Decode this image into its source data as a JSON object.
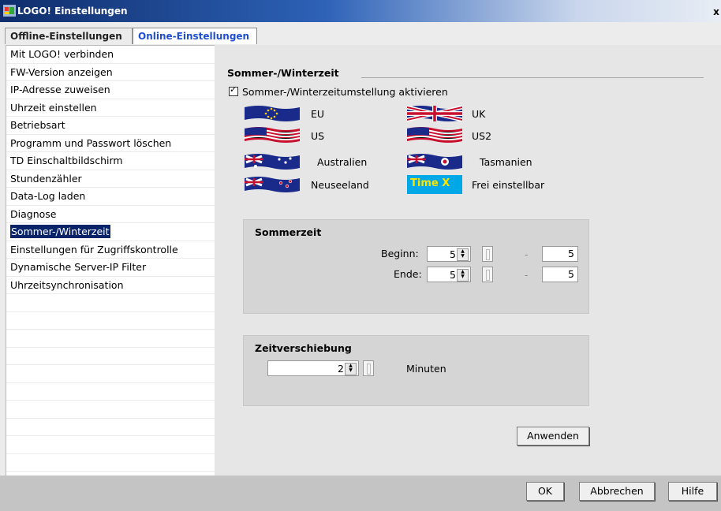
{
  "window": {
    "title": "LOGO! Einstellungen",
    "close_symbol": "x"
  },
  "tabs": [
    {
      "label": "Offline-Einstellungen",
      "active": false
    },
    {
      "label": "Online-Einstellungen",
      "active": true
    }
  ],
  "nav": {
    "items": [
      "Mit LOGO! verbinden",
      "FW-Version anzeigen",
      "IP-Adresse zuweisen",
      "Uhrzeit einstellen",
      "Betriebsart",
      "Programm und Passwort löschen",
      "TD Einschaltbildschirm",
      "Stundenzähler",
      "Data-Log laden",
      "Diagnose",
      "Sommer-/Winterzeit",
      "Einstellungen für Zugriffskontrolle",
      "Dynamische Server-IP Filter",
      "Uhrzeitsynchronisation"
    ],
    "selected_index": 10
  },
  "section": {
    "title": "Sommer-/Winterzeit",
    "checkbox_label": "Sommer-/Winterzeitumstellung aktivieren",
    "checkbox_checked": true
  },
  "presets": [
    {
      "label": "EU",
      "icon": "eu-flag-icon"
    },
    {
      "label": "UK",
      "icon": "uk-flag-icon"
    },
    {
      "label": "US",
      "icon": "us-flag-icon"
    },
    {
      "label": "US2",
      "icon": "us-flag-icon"
    },
    {
      "label": "Australien",
      "icon": "australia-flag-icon"
    },
    {
      "label": "Tasmanien",
      "icon": "tasmania-flag-icon"
    },
    {
      "label": "Neuseeland",
      "icon": "new-zealand-flag-icon"
    },
    {
      "label": "Frei einstellbar",
      "icon": "time-x-icon",
      "icon_text": "Time X"
    }
  ],
  "sommerzeit": {
    "title": "Sommerzeit",
    "begin_label": "Beginn:",
    "begin_value": "5",
    "begin_value2": "5",
    "end_label": "Ende:",
    "end_value": "5",
    "end_value2": "5",
    "separator": "-"
  },
  "zeitverschiebung": {
    "title": "Zeitverschiebung",
    "value": "2",
    "unit": "Minuten"
  },
  "buttons": {
    "apply": "Anwenden",
    "ok": "OK",
    "cancel": "Abbrechen",
    "help": "Hilfe"
  },
  "colors": {
    "selection": "#0a246a",
    "active_tab_text": "#1f4fcf",
    "panel_bg": "#d5d5d5"
  }
}
